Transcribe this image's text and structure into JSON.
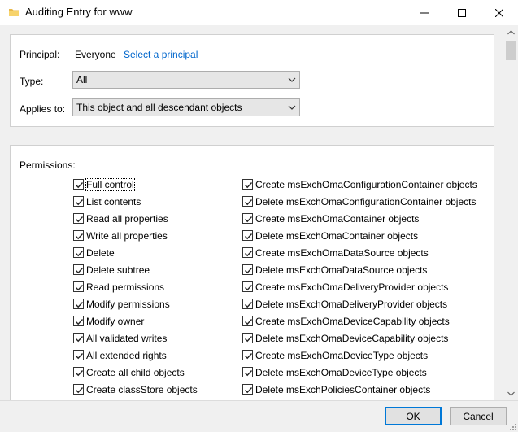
{
  "window": {
    "title": "Auditing Entry for www"
  },
  "principal": {
    "label": "Principal:",
    "value": "Everyone",
    "link": "Select a principal"
  },
  "type": {
    "label": "Type:",
    "value": "All"
  },
  "applies_to": {
    "label": "Applies to:",
    "value": "This object and all descendant objects"
  },
  "permissions": {
    "label": "Permissions:",
    "left": [
      {
        "label": "Full control",
        "checked": true
      },
      {
        "label": "List contents",
        "checked": true
      },
      {
        "label": "Read all properties",
        "checked": true
      },
      {
        "label": "Write all properties",
        "checked": true
      },
      {
        "label": "Delete",
        "checked": true
      },
      {
        "label": "Delete subtree",
        "checked": true
      },
      {
        "label": "Read permissions",
        "checked": true
      },
      {
        "label": "Modify permissions",
        "checked": true
      },
      {
        "label": "Modify owner",
        "checked": true
      },
      {
        "label": "All validated writes",
        "checked": true
      },
      {
        "label": "All extended rights",
        "checked": true
      },
      {
        "label": "Create all child objects",
        "checked": true
      },
      {
        "label": "Create classStore objects",
        "checked": true
      }
    ],
    "right": [
      {
        "label": "Create msExchOmaConfigurationContainer objects",
        "checked": true
      },
      {
        "label": "Delete msExchOmaConfigurationContainer objects",
        "checked": true
      },
      {
        "label": "Create msExchOmaContainer objects",
        "checked": true
      },
      {
        "label": "Delete msExchOmaContainer objects",
        "checked": true
      },
      {
        "label": "Create msExchOmaDataSource objects",
        "checked": true
      },
      {
        "label": "Delete msExchOmaDataSource objects",
        "checked": true
      },
      {
        "label": "Create msExchOmaDeliveryProvider objects",
        "checked": true
      },
      {
        "label": "Delete msExchOmaDeliveryProvider objects",
        "checked": true
      },
      {
        "label": "Create msExchOmaDeviceCapability objects",
        "checked": true
      },
      {
        "label": "Delete msExchOmaDeviceCapability objects",
        "checked": true
      },
      {
        "label": "Create msExchOmaDeviceType objects",
        "checked": true
      },
      {
        "label": "Delete msExchOmaDeviceType objects",
        "checked": true
      },
      {
        "label": "Delete msExchPoliciesContainer objects",
        "checked": true
      }
    ]
  },
  "buttons": {
    "ok": "OK",
    "cancel": "Cancel"
  },
  "colors": {
    "accent": "#0078d7",
    "link": "#0066cc",
    "folder": "#e8b84a"
  }
}
